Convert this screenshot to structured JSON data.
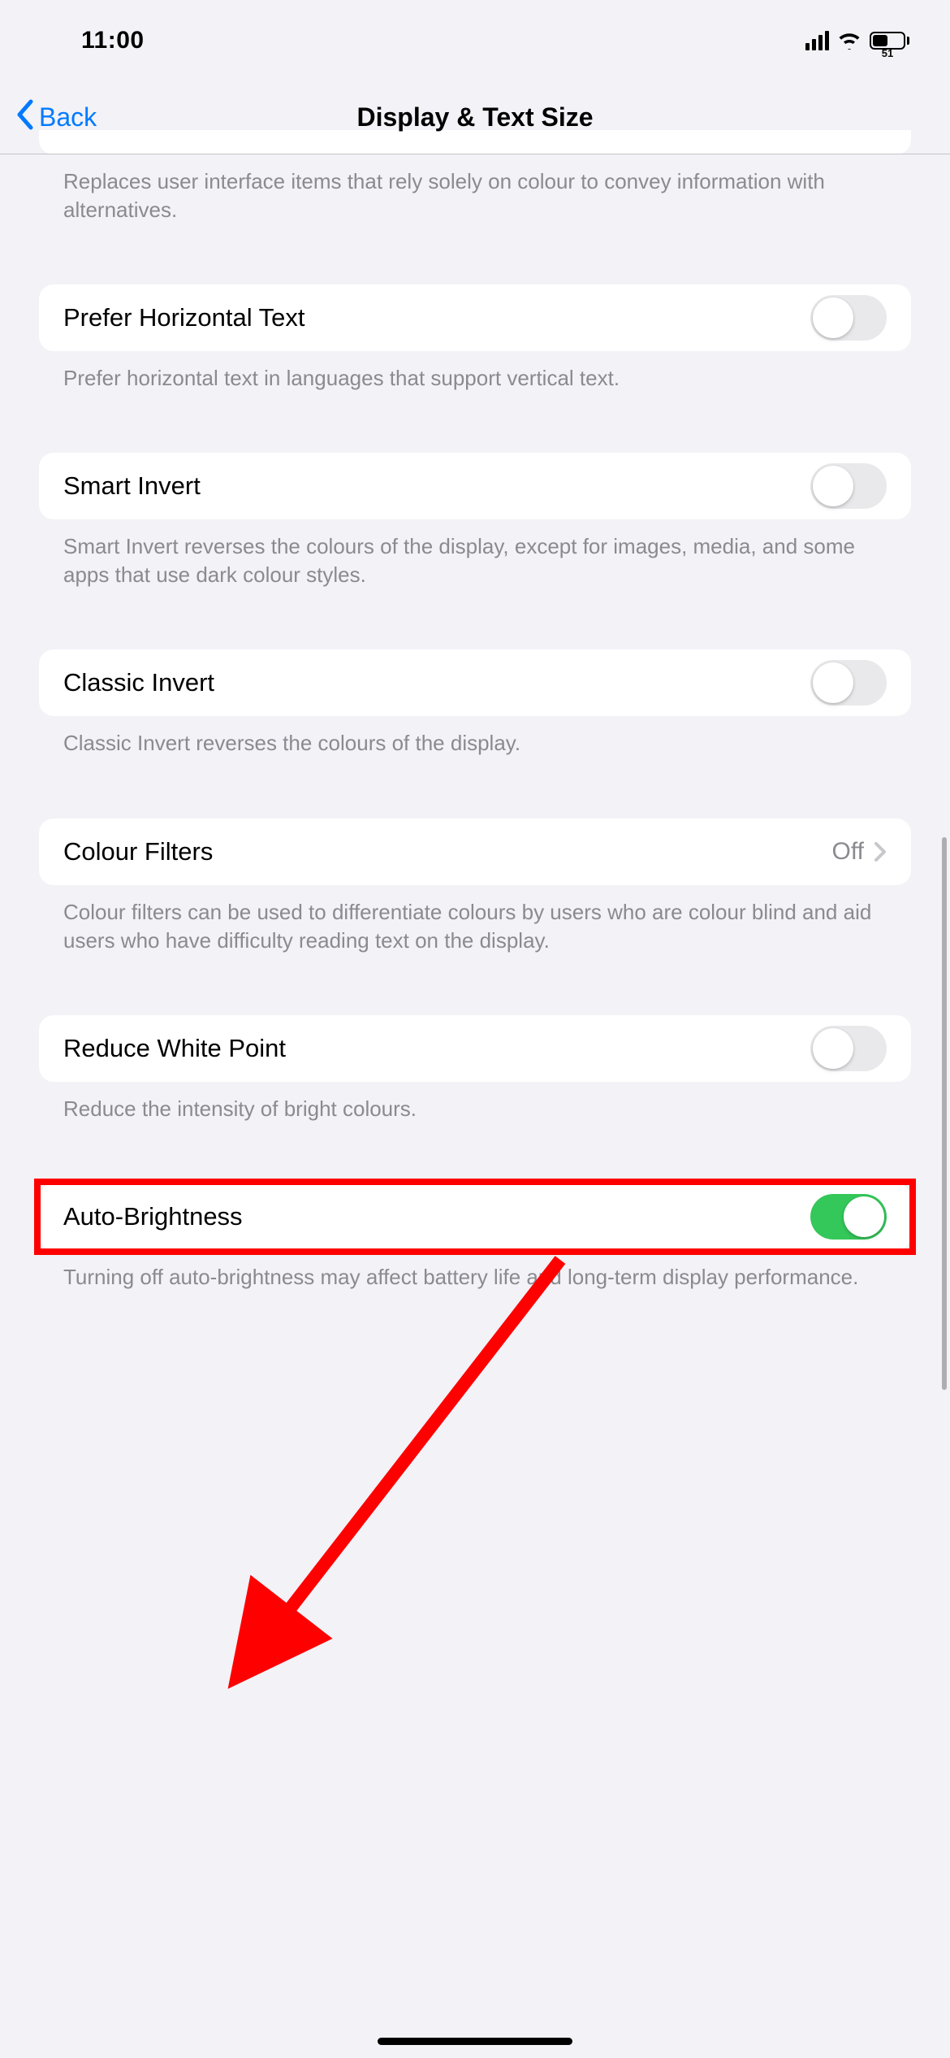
{
  "status": {
    "time": "11:00",
    "battery_pct": "51"
  },
  "nav": {
    "back_label": "Back",
    "title": "Display & Text Size"
  },
  "clipped_row_footer": "Replaces user interface items that rely solely on colour to convey information with alternatives.",
  "groups": [
    {
      "id": "prefer_horizontal_text",
      "label": "Prefer Horizontal Text",
      "type": "toggle",
      "on": false,
      "footer": "Prefer horizontal text in languages that support vertical text."
    },
    {
      "id": "smart_invert",
      "label": "Smart Invert",
      "type": "toggle",
      "on": false,
      "footer": "Smart Invert reverses the colours of the display, except for images, media, and some apps that use dark colour styles."
    },
    {
      "id": "classic_invert",
      "label": "Classic Invert",
      "type": "toggle",
      "on": false,
      "footer": "Classic Invert reverses the colours of the display."
    },
    {
      "id": "colour_filters",
      "label": "Colour Filters",
      "type": "disclosure",
      "value": "Off",
      "footer": "Colour filters can be used to differentiate colours by users who are colour blind and aid users who have difficulty reading text on the display."
    },
    {
      "id": "reduce_white_point",
      "label": "Reduce White Point",
      "type": "toggle",
      "on": false,
      "footer": "Reduce the intensity of bright colours."
    },
    {
      "id": "auto_brightness",
      "label": "Auto-Brightness",
      "type": "toggle",
      "on": true,
      "footer": "Turning off auto-brightness may affect battery life and long-term display performance."
    }
  ],
  "colors": {
    "accent": "#007aff",
    "toggle_on": "#34c759",
    "toggle_off": "#e9e9eb",
    "bg": "#f2f2f7",
    "secondary_text": "#8a8a8f",
    "annotation": "#ff0000"
  }
}
